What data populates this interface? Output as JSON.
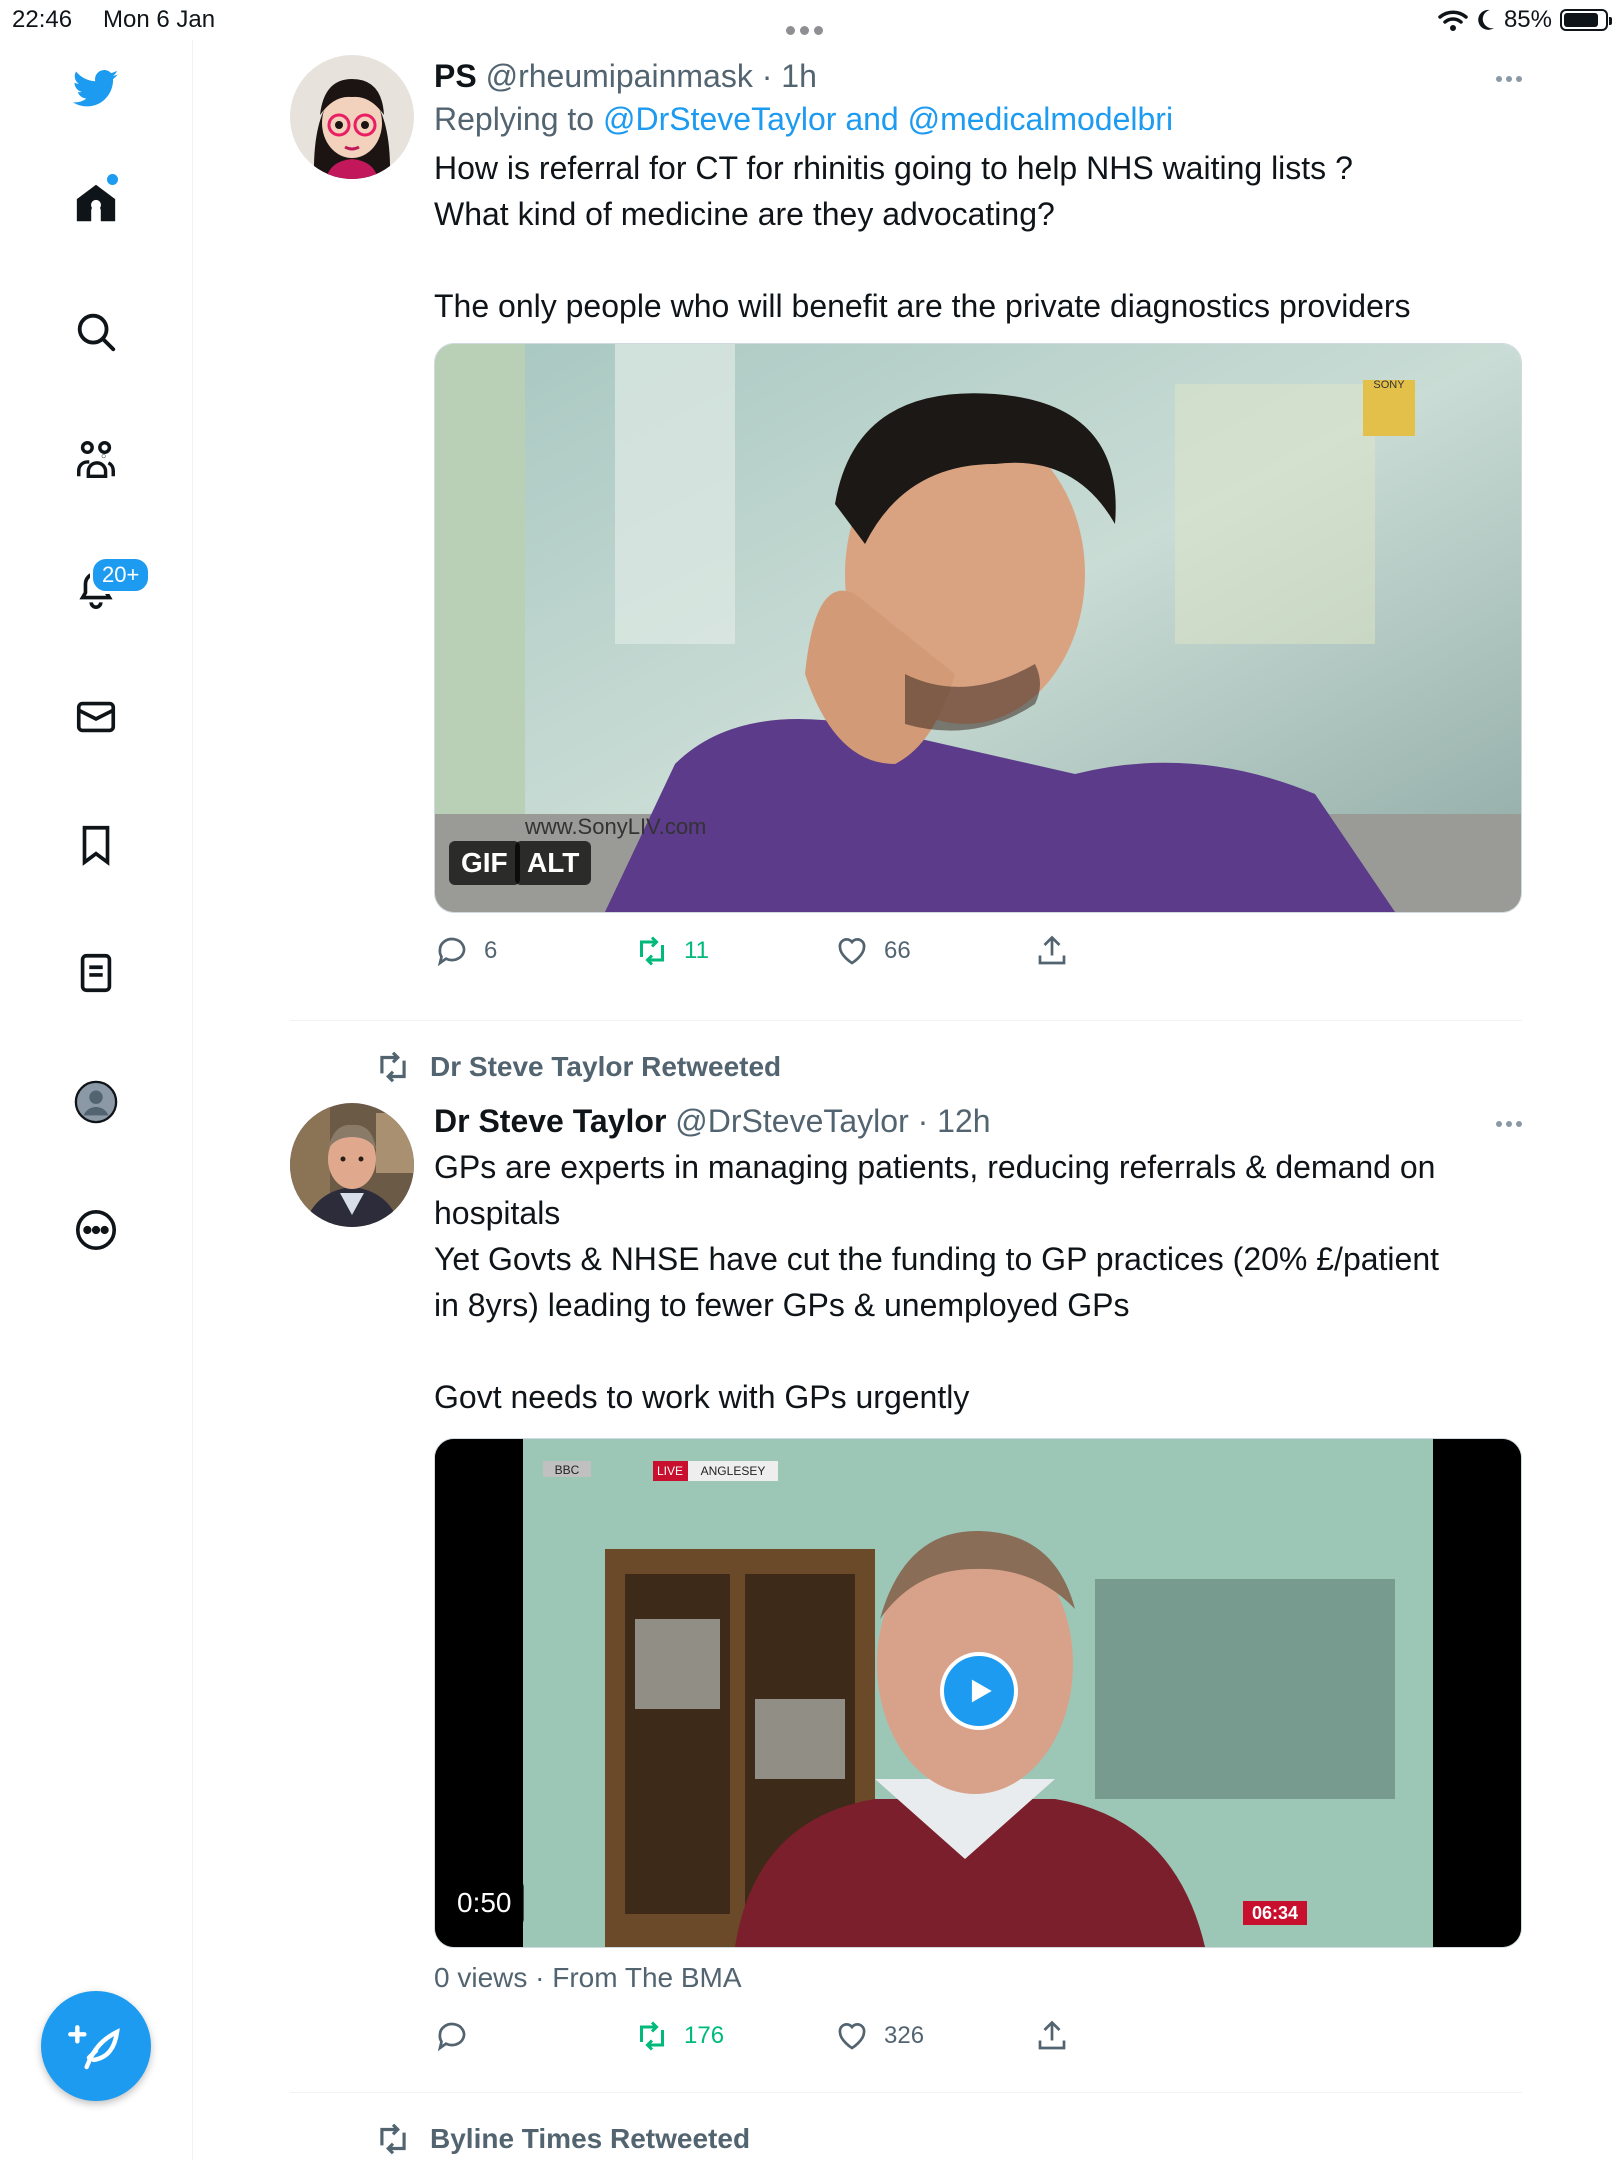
{
  "status_bar": {
    "time": "22:46",
    "date": "Mon 6 Jan",
    "battery": "85%",
    "battery_level": 0.85
  },
  "sidebar": {
    "notifications_badge": "20+",
    "items": [
      "twitter-logo",
      "home-icon",
      "search-icon",
      "communities-icon",
      "notifications-icon",
      "messages-icon",
      "bookmarks-icon",
      "lists-icon",
      "profile-icon",
      "more-icon"
    ]
  },
  "tweets": [
    {
      "name": "PS",
      "handle": "@rheumipainmask",
      "time": "· 1h",
      "replying_prefix": "Replying to ",
      "reply_to_1": "@DrSteveTaylor",
      "reply_and": " and ",
      "reply_to_2": "@medicalmodelbri",
      "text_line1": "How is referral for CT for rhinitis going to help NHS waiting lists ?",
      "text_line2": "What kind of medicine are they advocating?",
      "text_line3": "The only people who will benefit are the private diagnostics providers",
      "media": {
        "gif_label": "GIF",
        "alt_label": "ALT",
        "watermark_url": "www.SonyLIV.com",
        "channel_logo": "SONY"
      },
      "replies": "6",
      "retweets": "11",
      "likes": "66"
    },
    {
      "retweeted_by": "Dr Steve Taylor Retweeted",
      "name": "Dr Steve Taylor",
      "handle": "@DrSteveTaylor",
      "time": "· 12h",
      "text_line1": "GPs are experts in managing patients, reducing referrals & demand on",
      "text_line2": "hospitals",
      "text_line3": "Yet Govts & NHSE have cut the funding to GP practices (20% £/patient",
      "text_line4": "in 8yrs) leading to fewer GPs & unemployed GPs",
      "text_line5": "Govt needs to work with GPs urgently",
      "media": {
        "duration": "0:50",
        "bbc_logo": "BBC",
        "live_label": "LIVE",
        "location_label": "ANGLESEY",
        "clock": "06:34"
      },
      "views_source": "0 views · From The BMA",
      "replies": "",
      "retweets": "176",
      "likes": "326"
    },
    {
      "retweeted_by": "Byline Times Retweeted"
    }
  ]
}
